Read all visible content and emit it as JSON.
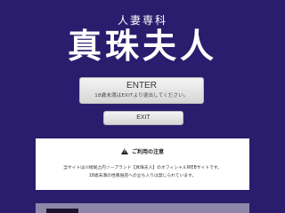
{
  "logo": {
    "subtitle": "人妻専科",
    "title": "真珠夫人"
  },
  "enter": {
    "label": "ENTER",
    "sub": "18歳未満はEXITより退出してください。"
  },
  "exit": {
    "label": "EXIT"
  },
  "notice": {
    "heading": "ご利用の注意",
    "line1": "当サイトは川崎堀之内ソープランド【真珠夫人】のオフィシャルWEBサイトです。",
    "line2": "18歳未満の性風俗店への立ち入りは禁じられています。"
  },
  "colors": {
    "background": "#2a1d6e",
    "button": "#e6e6e6",
    "notice_bg": "#ffffff"
  },
  "icons": {
    "warning": "warning-icon"
  }
}
